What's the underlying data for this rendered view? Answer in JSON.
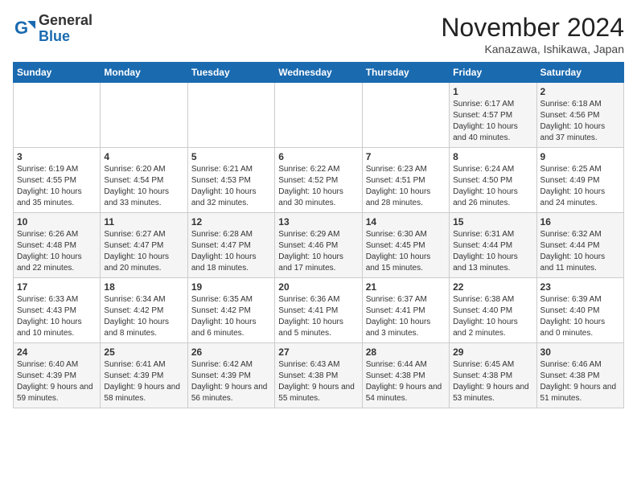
{
  "logo": {
    "line1": "General",
    "line2": "Blue"
  },
  "title": "November 2024",
  "location": "Kanazawa, Ishikawa, Japan",
  "days_of_week": [
    "Sunday",
    "Monday",
    "Tuesday",
    "Wednesday",
    "Thursday",
    "Friday",
    "Saturday"
  ],
  "weeks": [
    [
      {
        "day": "",
        "info": ""
      },
      {
        "day": "",
        "info": ""
      },
      {
        "day": "",
        "info": ""
      },
      {
        "day": "",
        "info": ""
      },
      {
        "day": "",
        "info": ""
      },
      {
        "day": "1",
        "info": "Sunrise: 6:17 AM\nSunset: 4:57 PM\nDaylight: 10 hours and 40 minutes."
      },
      {
        "day": "2",
        "info": "Sunrise: 6:18 AM\nSunset: 4:56 PM\nDaylight: 10 hours and 37 minutes."
      }
    ],
    [
      {
        "day": "3",
        "info": "Sunrise: 6:19 AM\nSunset: 4:55 PM\nDaylight: 10 hours and 35 minutes."
      },
      {
        "day": "4",
        "info": "Sunrise: 6:20 AM\nSunset: 4:54 PM\nDaylight: 10 hours and 33 minutes."
      },
      {
        "day": "5",
        "info": "Sunrise: 6:21 AM\nSunset: 4:53 PM\nDaylight: 10 hours and 32 minutes."
      },
      {
        "day": "6",
        "info": "Sunrise: 6:22 AM\nSunset: 4:52 PM\nDaylight: 10 hours and 30 minutes."
      },
      {
        "day": "7",
        "info": "Sunrise: 6:23 AM\nSunset: 4:51 PM\nDaylight: 10 hours and 28 minutes."
      },
      {
        "day": "8",
        "info": "Sunrise: 6:24 AM\nSunset: 4:50 PM\nDaylight: 10 hours and 26 minutes."
      },
      {
        "day": "9",
        "info": "Sunrise: 6:25 AM\nSunset: 4:49 PM\nDaylight: 10 hours and 24 minutes."
      }
    ],
    [
      {
        "day": "10",
        "info": "Sunrise: 6:26 AM\nSunset: 4:48 PM\nDaylight: 10 hours and 22 minutes."
      },
      {
        "day": "11",
        "info": "Sunrise: 6:27 AM\nSunset: 4:47 PM\nDaylight: 10 hours and 20 minutes."
      },
      {
        "day": "12",
        "info": "Sunrise: 6:28 AM\nSunset: 4:47 PM\nDaylight: 10 hours and 18 minutes."
      },
      {
        "day": "13",
        "info": "Sunrise: 6:29 AM\nSunset: 4:46 PM\nDaylight: 10 hours and 17 minutes."
      },
      {
        "day": "14",
        "info": "Sunrise: 6:30 AM\nSunset: 4:45 PM\nDaylight: 10 hours and 15 minutes."
      },
      {
        "day": "15",
        "info": "Sunrise: 6:31 AM\nSunset: 4:44 PM\nDaylight: 10 hours and 13 minutes."
      },
      {
        "day": "16",
        "info": "Sunrise: 6:32 AM\nSunset: 4:44 PM\nDaylight: 10 hours and 11 minutes."
      }
    ],
    [
      {
        "day": "17",
        "info": "Sunrise: 6:33 AM\nSunset: 4:43 PM\nDaylight: 10 hours and 10 minutes."
      },
      {
        "day": "18",
        "info": "Sunrise: 6:34 AM\nSunset: 4:42 PM\nDaylight: 10 hours and 8 minutes."
      },
      {
        "day": "19",
        "info": "Sunrise: 6:35 AM\nSunset: 4:42 PM\nDaylight: 10 hours and 6 minutes."
      },
      {
        "day": "20",
        "info": "Sunrise: 6:36 AM\nSunset: 4:41 PM\nDaylight: 10 hours and 5 minutes."
      },
      {
        "day": "21",
        "info": "Sunrise: 6:37 AM\nSunset: 4:41 PM\nDaylight: 10 hours and 3 minutes."
      },
      {
        "day": "22",
        "info": "Sunrise: 6:38 AM\nSunset: 4:40 PM\nDaylight: 10 hours and 2 minutes."
      },
      {
        "day": "23",
        "info": "Sunrise: 6:39 AM\nSunset: 4:40 PM\nDaylight: 10 hours and 0 minutes."
      }
    ],
    [
      {
        "day": "24",
        "info": "Sunrise: 6:40 AM\nSunset: 4:39 PM\nDaylight: 9 hours and 59 minutes."
      },
      {
        "day": "25",
        "info": "Sunrise: 6:41 AM\nSunset: 4:39 PM\nDaylight: 9 hours and 58 minutes."
      },
      {
        "day": "26",
        "info": "Sunrise: 6:42 AM\nSunset: 4:39 PM\nDaylight: 9 hours and 56 minutes."
      },
      {
        "day": "27",
        "info": "Sunrise: 6:43 AM\nSunset: 4:38 PM\nDaylight: 9 hours and 55 minutes."
      },
      {
        "day": "28",
        "info": "Sunrise: 6:44 AM\nSunset: 4:38 PM\nDaylight: 9 hours and 54 minutes."
      },
      {
        "day": "29",
        "info": "Sunrise: 6:45 AM\nSunset: 4:38 PM\nDaylight: 9 hours and 53 minutes."
      },
      {
        "day": "30",
        "info": "Sunrise: 6:46 AM\nSunset: 4:38 PM\nDaylight: 9 hours and 51 minutes."
      }
    ]
  ]
}
